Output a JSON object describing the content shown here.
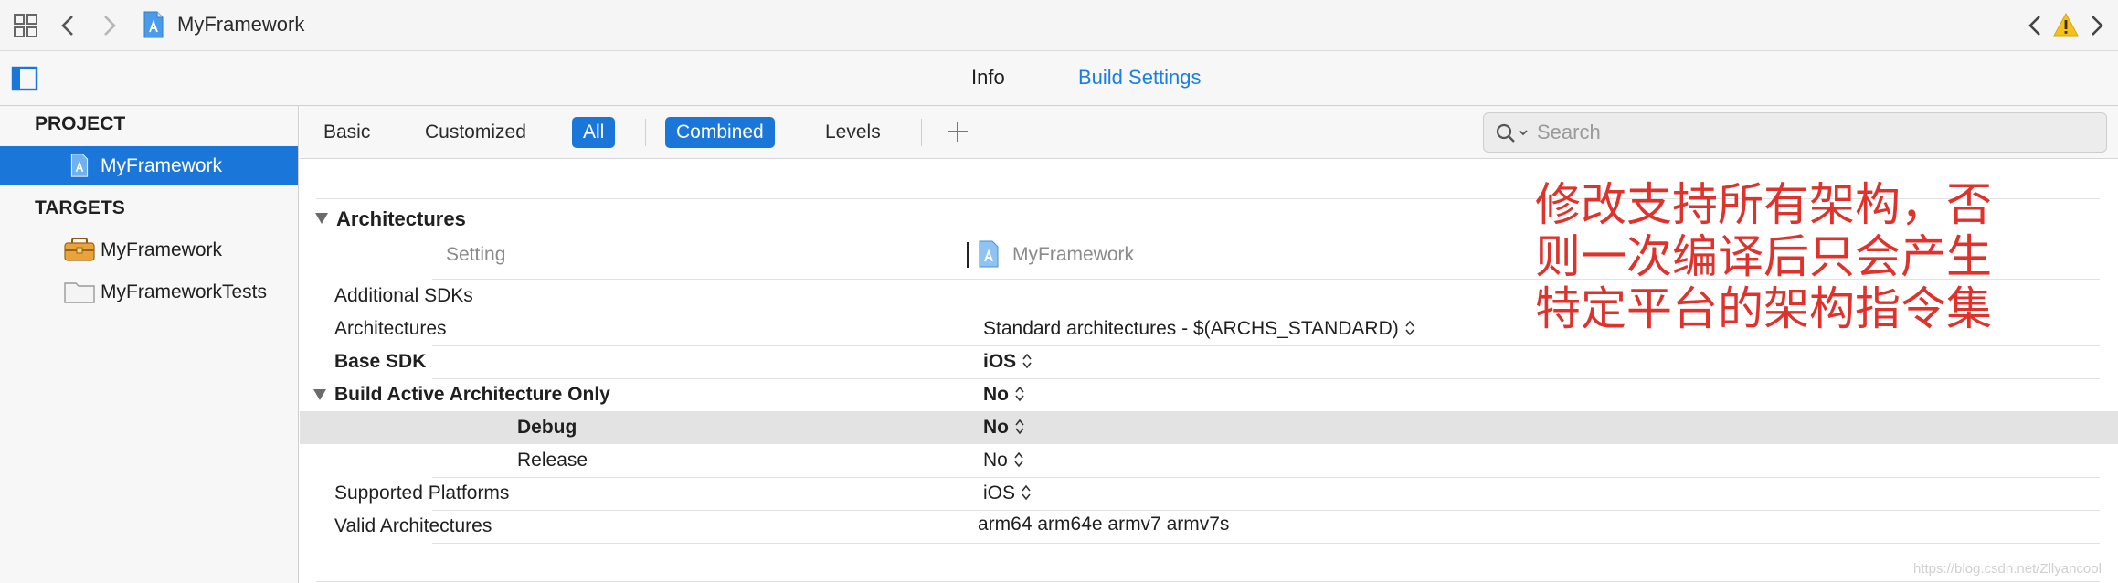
{
  "nav": {
    "project_name": "MyFramework"
  },
  "editor_tabs": {
    "info": "Info",
    "build_settings": "Build Settings",
    "active_color": "#1a7fe0"
  },
  "sidebar": {
    "project_heading": "PROJECT",
    "project_item": "MyFramework",
    "targets_heading": "TARGETS",
    "targets": [
      "MyFramework",
      "MyFrameworkTests"
    ],
    "selected_color": "#1b76d9"
  },
  "filter": {
    "basic": "Basic",
    "customized": "Customized",
    "all": "All",
    "combined": "Combined",
    "levels": "Levels",
    "search_placeholder": "Search"
  },
  "settings": {
    "section_title": "Architectures",
    "column_setting": "Setting",
    "column_target": "MyFramework",
    "rows": [
      {
        "name": "Additional SDKs",
        "value": ""
      },
      {
        "name": "Architectures",
        "value": "Standard architectures  -  $(ARCHS_STANDARD)"
      },
      {
        "name": "Base SDK",
        "value": "iOS"
      },
      {
        "name": "Build Active Architecture Only",
        "value": "No"
      },
      {
        "name": "Debug",
        "value": "No"
      },
      {
        "name": "Release",
        "value": "No"
      },
      {
        "name": "Supported Platforms",
        "value": "iOS"
      },
      {
        "name": "Valid Architectures",
        "value": "arm64 arm64e armv7 armv7s"
      }
    ]
  },
  "annotation": {
    "lines": [
      "修改支持所有架构，否",
      "则一次编译后只会产生",
      "特定平台的架构指令集"
    ],
    "color": "#e0322c"
  },
  "watermark": "https://blog.csdn.net/Zllyancool"
}
